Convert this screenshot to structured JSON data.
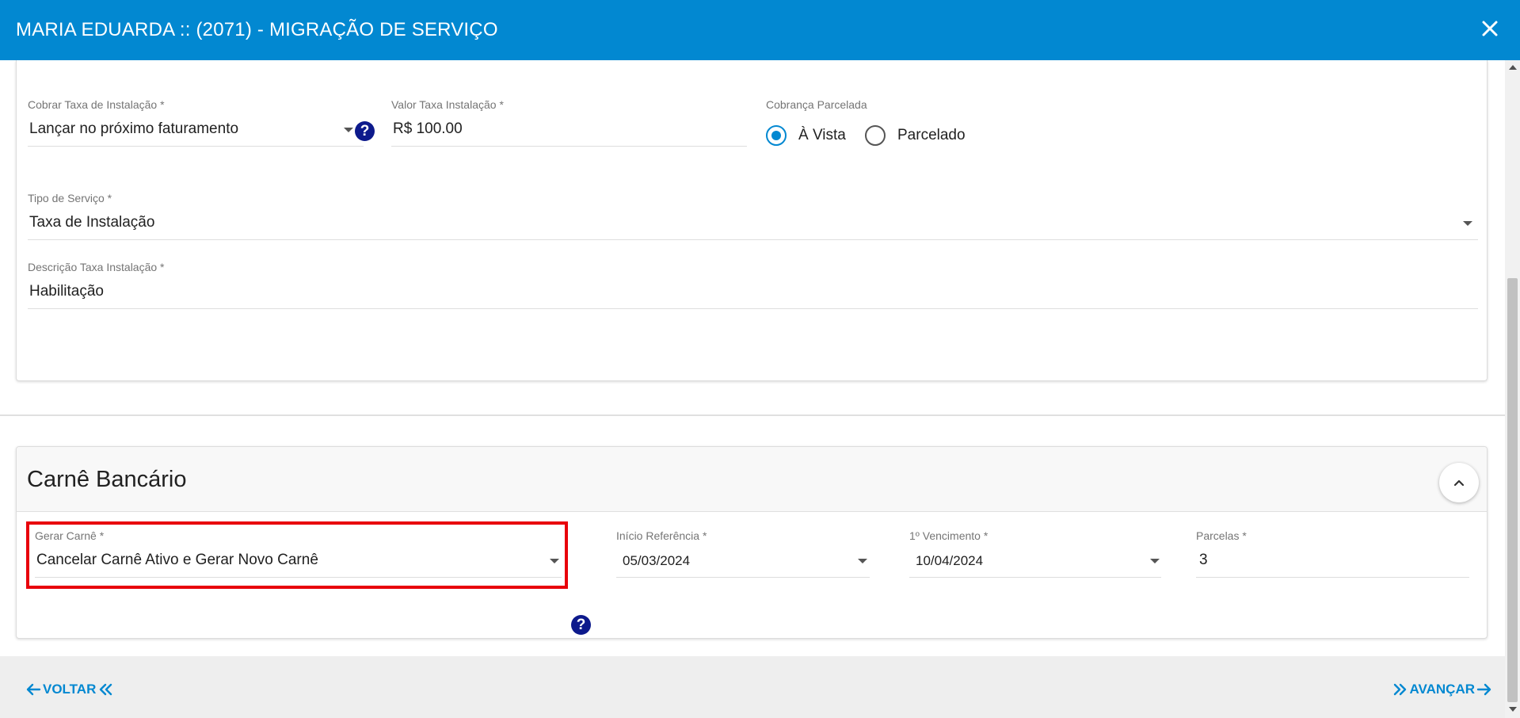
{
  "header": {
    "title": "MARIA EDUARDA :: (2071) - MIGRAÇÃO DE SERVIÇO",
    "close_icon": "close-icon"
  },
  "installation": {
    "charge_fee": {
      "label": "Cobrar Taxa de Instalação *",
      "value": "Lançar no próximo faturamento"
    },
    "fee_value": {
      "label": "Valor Taxa Instalação *",
      "value": "R$ 100.00"
    },
    "installments": {
      "label": "Cobrança Parcelada",
      "options": [
        {
          "label": "À Vista",
          "checked": true
        },
        {
          "label": "Parcelado",
          "checked": false
        }
      ]
    },
    "service_type": {
      "label": "Tipo de Serviço *",
      "value": "Taxa de Instalação"
    },
    "description": {
      "label": "Descrição Taxa Instalação *",
      "value": "Habilitação"
    }
  },
  "carne": {
    "title": "Carnê Bancário",
    "generate": {
      "label": "Gerar Carnê *",
      "value": "Cancelar Carnê Ativo e Gerar Novo Carnê"
    },
    "start_ref": {
      "label": "Início Referência *",
      "value": "05/03/2024"
    },
    "first_due": {
      "label": "1º Vencimento *",
      "value": "10/04/2024"
    },
    "installments": {
      "label": "Parcelas *",
      "value": "3"
    }
  },
  "footer": {
    "back_label": "VOLTAR",
    "next_label": "AVANÇAR"
  },
  "colors": {
    "primary": "#0288d1",
    "help": "#0d1a8c",
    "highlight": "#e8000b"
  }
}
